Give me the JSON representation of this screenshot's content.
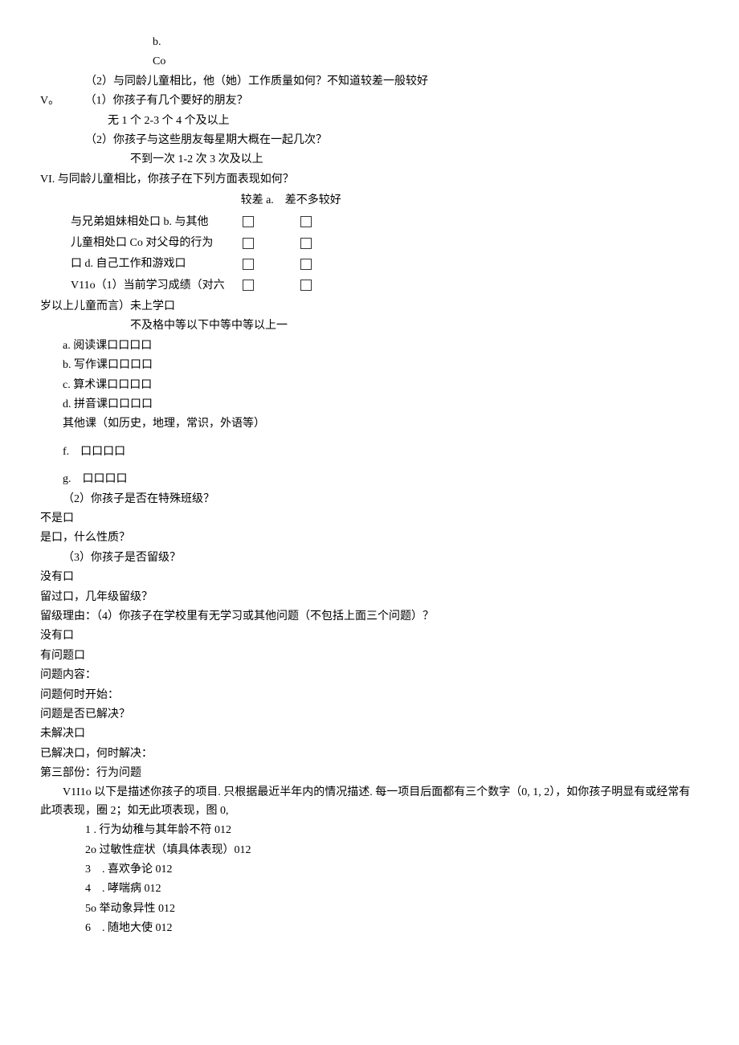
{
  "l1": "b.",
  "l2": "Co",
  "l3": "（2）与同龄儿童相比，他（她）工作质量如何？不知道较差一般较好",
  "l4a": "V。",
  "l4b": "（1）你孩子有几个要好的朋友？",
  "l5": "无 1 个 2-3 个 4 个及以上",
  "l6": "（2）你孩子与这些朋友每星期大概在一起几次？",
  "l7": "不到一次 1-2 次 3 次及以上",
  "l8": "VI. 与同龄儿童相比，你孩子在下列方面表现如何？",
  "tblHead": "较差 a.　差不多较好",
  "r1": "与兄弟姐妹相处口 b. 与其他",
  "r2": "儿童相处口 Co 对父母的行为",
  "r3": "口 d. 自己工作和游戏口",
  "r4a": "V11o（1）当前学习成绩（对六",
  "r4b": "岁以上儿童而言）未上学口",
  "l13": "不及格中等以下中等中等以上一",
  "l14": "a. 阅读课口口口口",
  "l15": "b. 写作课口口口口",
  "l16": "c. 算术课口口口口",
  "l17": "d. 拼音课口口口口",
  "l18": "其他课（如历史，地理，常识，外语等）",
  "l19": "f.　口口口口",
  "l20": "g.　口口口口",
  "l21": "（2）你孩子是否在特殊班级？",
  "l22": "不是口",
  "l23": "是口，什么性质？",
  "l24": "（3）你孩子是否留级？",
  "l25": "没有口",
  "l26": "留过口，几年级留级？",
  "l27": "留级理由：（4）你孩子在学校里有无学习或其他问题（不包括上面三个问题）？",
  "l28": "没有口",
  "l29": "有问题口",
  "l30": "问题内容：",
  "l31": "问题何时开始：",
  "l32": "问题是否已解决？",
  "l33": "未解决口",
  "l34": "已解决口，何时解决：",
  "l35": "第三部份：行为问题",
  "l36": "V1I1o 以下是描述你孩子的项目. 只根据最近半年内的情况描述. 每一项目后面都有三个数字（0, 1, 2），如你孩子明显有或经常有此项表现，圈 2；如无此项表现，图 0,",
  "bi1": "1 . 行为幼稚与其年龄不符 012",
  "bi2": "2o 过敏性症状（填具体表现）012",
  "bi3": "3　. 喜欢争论 012",
  "bi4": "4　. 哮喘病 012",
  "bi5": "5o 举动象异性 012",
  "bi6": "6　. 随地大使 012"
}
